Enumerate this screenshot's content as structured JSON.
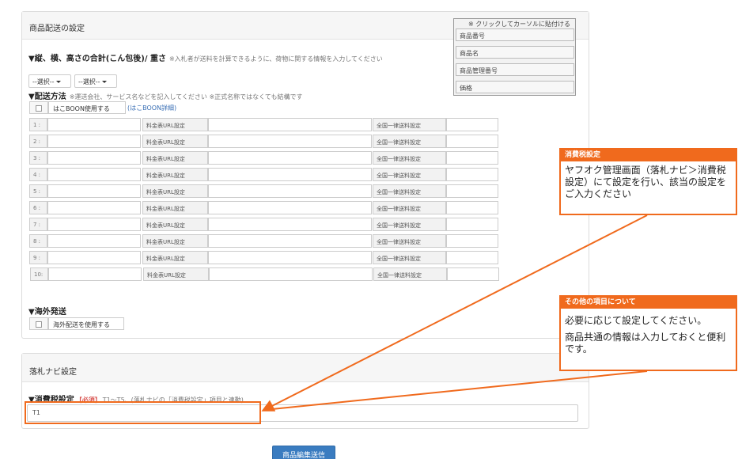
{
  "shipping": {
    "panel_title": "商品配送の設定",
    "size_heading": "▼縦、横、高さの合計(こん包後)/ 重さ",
    "size_note": "※入札者が送料を計算できるように、荷物に関する情報を入力してください",
    "select1": "--選択--",
    "select2": "--選択--",
    "method_heading": "▼配送方法",
    "method_note": "※運送会社、サービス名などを記入してください ※正式名称ではなくても結構です",
    "hakoboon_label": "はこBOON使用する",
    "hakoboon_link": "(はこBOON詳細)",
    "rows": [
      {
        "num": "1 :",
        "fee_label": "料金表URL設定",
        "flat_label": "全国一律送料設定"
      },
      {
        "num": "2 :",
        "fee_label": "料金表URL設定",
        "flat_label": "全国一律送料設定"
      },
      {
        "num": "3 :",
        "fee_label": "料金表URL設定",
        "flat_label": "全国一律送料設定"
      },
      {
        "num": "4 :",
        "fee_label": "料金表URL設定",
        "flat_label": "全国一律送料設定"
      },
      {
        "num": "5 :",
        "fee_label": "料金表URL設定",
        "flat_label": "全国一律送料設定"
      },
      {
        "num": "6 :",
        "fee_label": "料金表URL設定",
        "flat_label": "全国一律送料設定"
      },
      {
        "num": "7 :",
        "fee_label": "料金表URL設定",
        "flat_label": "全国一律送料設定"
      },
      {
        "num": "8 :",
        "fee_label": "料金表URL設定",
        "flat_label": "全国一律送料設定"
      },
      {
        "num": "9 :",
        "fee_label": "料金表URL設定",
        "flat_label": "全国一律送料設定"
      },
      {
        "num": "10:",
        "fee_label": "料金表URL設定",
        "flat_label": "全国一律送料設定"
      }
    ],
    "overseas_heading": "▼海外発送",
    "overseas_label": "海外配送を使用する"
  },
  "insert_box": {
    "header": "※ クリックしてカーソルに貼付ける",
    "items": [
      "商品番号",
      "商品名",
      "商品管理番号",
      "価格"
    ]
  },
  "callouts": {
    "tax": {
      "title": "消費税設定",
      "body": "ヤフオク管理画面（落札ナビ＞消費税設定）にて設定を行い、該当の設定をご入力ください"
    },
    "other": {
      "title": "その他の項目について",
      "body1": "必要に応じて設定してください。",
      "body2": "商品共通の情報は入力しておくと便利です。"
    }
  },
  "navi": {
    "panel_title": "落札ナビ設定",
    "tax_heading": "▼消費税設定",
    "tax_required": "【必須】",
    "tax_note": "T1〜T5、(落札ナビの「消費税設定」項目と連動)",
    "tax_value": "T1"
  },
  "submit_label": "商品編集送信",
  "colors": {
    "accent_orange": "#f06a1d",
    "submit_blue": "#3a7cc0",
    "link_blue": "#3a6fb5",
    "required_red": "#d9534f"
  }
}
